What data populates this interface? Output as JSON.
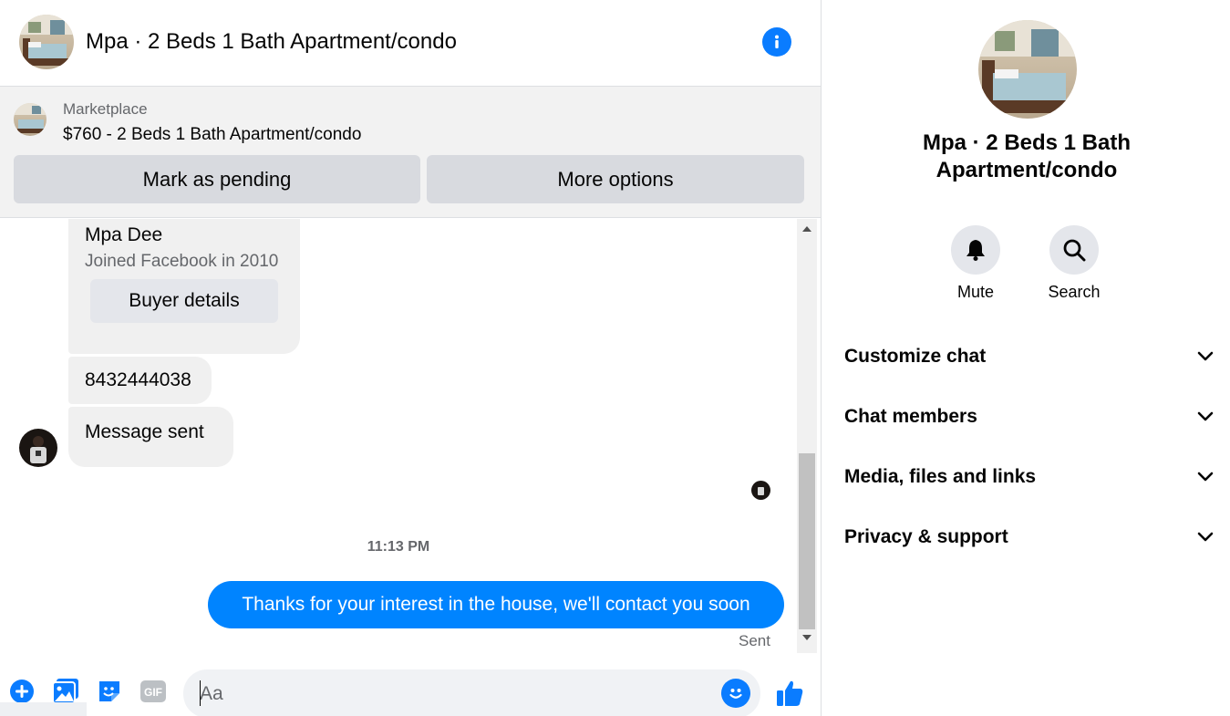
{
  "header": {
    "title": "Mpa · 2 Beds 1 Bath Apartment/condo",
    "info_icon": "info-icon"
  },
  "marketplace": {
    "label": "Marketplace",
    "listing": "$760 - 2 Beds 1 Bath Apartment/condo",
    "pending_button": "Mark as pending",
    "more_button": "More options"
  },
  "messages": {
    "card": {
      "name": "Mpa Dee",
      "subtitle": "Joined Facebook in 2010",
      "button": "Buyer details"
    },
    "phone": "8432444038",
    "note": "Message sent",
    "timestamp": "11:13 PM",
    "outgoing": "Thanks for your interest in the house, we'll contact you soon",
    "delivery_status": "Sent"
  },
  "composer": {
    "placeholder": "Aa",
    "icons": [
      "add-icon",
      "photo-icon",
      "sticker-icon",
      "gif-icon",
      "emoji-icon",
      "thumbs-up-icon"
    ]
  },
  "panel": {
    "title": "Mpa · 2 Beds 1 Bath Apartment/condo",
    "actions": [
      {
        "label": "Mute",
        "icon": "bell-icon"
      },
      {
        "label": "Search",
        "icon": "search-icon"
      }
    ],
    "sections": [
      {
        "label": "Customize chat"
      },
      {
        "label": "Chat members"
      },
      {
        "label": "Media, files and links"
      },
      {
        "label": "Privacy & support"
      }
    ]
  },
  "colors": {
    "accent": "#0084ff",
    "icon_blue": "#0a7cff",
    "banner_bg": "#f2f2f2",
    "bubble_gray": "#f0f0f0"
  }
}
